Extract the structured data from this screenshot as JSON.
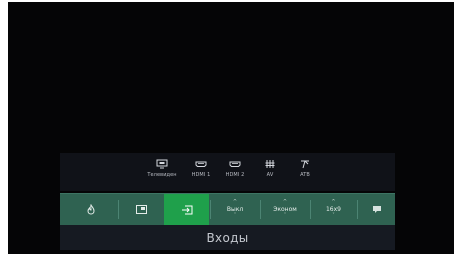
{
  "sources": [
    {
      "label": "Телевиден",
      "icon": "tv-icon"
    },
    {
      "label": "HDMI 1",
      "icon": "hdmi-icon"
    },
    {
      "label": "HDMI 2",
      "icon": "hdmi-icon"
    },
    {
      "label": "AV",
      "icon": "av-icon"
    },
    {
      "label": "ATB",
      "icon": "antenna-icon"
    }
  ],
  "bar": {
    "power_icon": "flame-icon",
    "pip_icon": "picture-in-picture-icon",
    "input_icon": "input-icon",
    "options": [
      {
        "value": "Выкл"
      },
      {
        "value": "Эконом"
      },
      {
        "value": "16x9"
      }
    ],
    "speech_icon": "chat-icon"
  },
  "title": "Входы",
  "colors": {
    "bar": "#2f6251",
    "active": "#1fa04b",
    "title_bg": "#161a22",
    "screen": "#050506"
  }
}
